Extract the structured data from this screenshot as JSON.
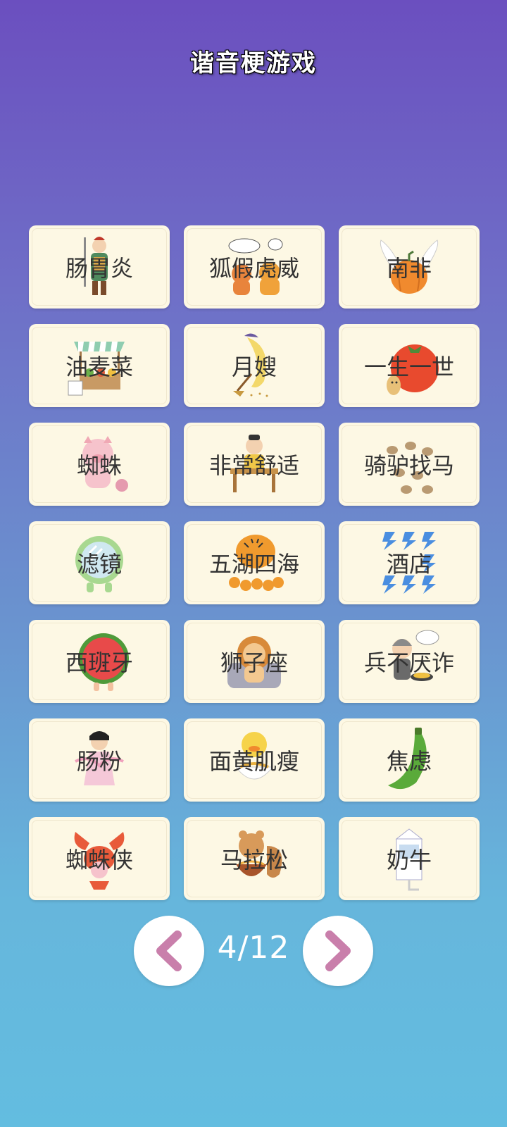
{
  "header": {
    "title": "谐音梗游戏"
  },
  "grid": {
    "cards": [
      {
        "label": "肠胃炎",
        "icon": "general-figure-icon"
      },
      {
        "label": "狐假虎威",
        "icon": "fox-and-tiger-icon"
      },
      {
        "label": "南非",
        "icon": "winged-pumpkin-icon"
      },
      {
        "label": "油麦菜",
        "icon": "vegetable-stall-icon"
      },
      {
        "label": "月嫂",
        "icon": "moon-sweeping-icon"
      },
      {
        "label": "一生一世",
        "icon": "tomato-peanut-icon"
      },
      {
        "label": "蜘蛛",
        "icon": "pig-with-yarn-icon"
      },
      {
        "label": "非常舒适",
        "icon": "scholar-at-desk-icon"
      },
      {
        "label": "骑驴找马",
        "icon": "donkeys-icon"
      },
      {
        "label": "滤镜",
        "icon": "green-mirror-icon"
      },
      {
        "label": "五湖四海",
        "icon": "tiger-family-icon"
      },
      {
        "label": "酒店",
        "icon": "lightning-bolts-icon"
      },
      {
        "label": "西班牙",
        "icon": "watermelon-icon"
      },
      {
        "label": "狮子座",
        "icon": "lion-on-sofa-icon"
      },
      {
        "label": "兵不厌诈",
        "icon": "soldier-frying-icon"
      },
      {
        "label": "肠粉",
        "icon": "fairy-girl-icon"
      },
      {
        "label": "面黄肌瘦",
        "icon": "duck-noodles-icon"
      },
      {
        "label": "焦虑",
        "icon": "green-banana-icon"
      },
      {
        "label": "蜘蛛侠",
        "icon": "lobster-pig-icon"
      },
      {
        "label": "马拉松",
        "icon": "squirrel-noodles-icon"
      },
      {
        "label": "奶牛",
        "icon": "milk-carton-icon"
      }
    ]
  },
  "pager": {
    "indicator": "4/12",
    "prev_icon": "chevron-left-icon",
    "next_icon": "chevron-right-icon",
    "accent_color": "#c97fab"
  },
  "colors": {
    "card_background": "#fdf8e4",
    "background_top": "#6b4fbf",
    "background_bottom": "#63bde0"
  }
}
